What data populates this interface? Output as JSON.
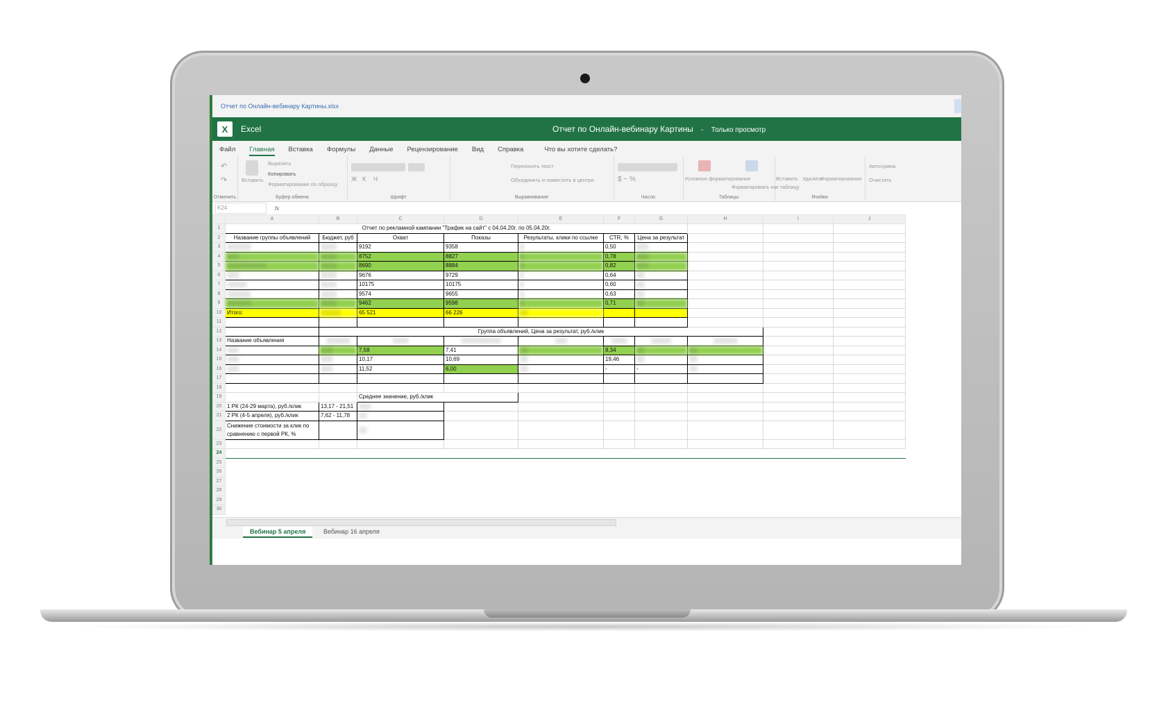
{
  "window": {
    "file_name": "Отчет по Онлайн-вебинару Картины.xlsx",
    "app_name": "Excel",
    "doc_title": "Отчет по Онлайн-вебинару Картины",
    "separator": "-",
    "mode": "Только просмотр"
  },
  "ribbon_tabs": [
    "Файл",
    "Главная",
    "Вставка",
    "Формулы",
    "Данные",
    "Рецензирование",
    "Вид",
    "Справка",
    "Что вы хотите сделать?"
  ],
  "ribbon": {
    "undo_group": "Отменить",
    "paste": "Вставить",
    "cut": "Вырезать",
    "copy": "Копировать",
    "format_painter": "Форматирование по образцу",
    "clipboard": "Буфер обмена",
    "font": "Шрифт",
    "wrap_text": "Переносить текст",
    "merge_center": "Объединить и поместить в центре",
    "alignment": "Выравнивание",
    "number": "Число",
    "cond_format": "Условное форматирование",
    "format_table": "Форматировать как таблицу",
    "tables": "Таблицы",
    "insert": "Вставить",
    "delete": "Удалить",
    "format": "Форматирование",
    "cells": "Ячейки",
    "autosum": "Автосумма",
    "clear": "Очистить"
  },
  "formula_bar": {
    "cell": "K24",
    "fx": "fx"
  },
  "columns": [
    "A",
    "B",
    "C",
    "D",
    "E",
    "F",
    "G",
    "H",
    "I",
    "J"
  ],
  "sheet": {
    "title": "Отчет по рекламной кампании \"Трафик на сайт\" с 04.04.20г. по 05.04.20г.",
    "headers": [
      "Название группы объявлений",
      "Бюджет, руб",
      "Охват",
      "Показы",
      "Результаты, клики по ссылке",
      "CTR, %",
      "Цена за результат"
    ],
    "rows": [
      {
        "reach": "9192",
        "shows": "9358",
        "ctr": "0,50"
      },
      {
        "reach": "8752",
        "shows": "8827",
        "ctr": "0,78"
      },
      {
        "reach": "8690",
        "shows": "8884",
        "ctr": "0,82"
      },
      {
        "reach": "9676",
        "shows": "9729",
        "ctr": "0,64"
      },
      {
        "reach": "10175",
        "shows": "10175",
        "ctr": "0,60"
      },
      {
        "reach": "9574",
        "shows": "9655",
        "ctr": "0,63"
      },
      {
        "reach": "9462",
        "shows": "9598",
        "ctr": "0,71"
      }
    ],
    "total_label": "Итого:",
    "total_reach": "65 521",
    "total_shows": "66 226",
    "group_title": "Группа объявлений, Цена за результат, руб./клик",
    "ad_name_header": "Название объявления",
    "ad_rows": [
      {
        "c": "7,58",
        "d": "7,41",
        "f": "8,34"
      },
      {
        "c": "10,17",
        "d": "10,69",
        "f": "19,46"
      },
      {
        "c": "11,52",
        "d": "6,00",
        "f": "-",
        "g": "-"
      }
    ],
    "avg_label": "Среднее значение, руб./клик",
    "rk1_label": "1 РК (24-29 марта), руб./клик",
    "rk1_range": "13,17 - 21,51",
    "rk2_label": "2 РК (4-5 апреля), руб./клик",
    "rk2_range": "7,62 - 11,78",
    "reduction_label_1": "Снижение стоимости за клик по",
    "reduction_label_2": "сравнению с первой РК, %"
  },
  "sheet_tabs": [
    "Вебинар 5 апреля",
    "Вебинар 16 апреля"
  ],
  "colors": {
    "green": "#92d050",
    "yellow": "#ffff00",
    "excel": "#217346"
  }
}
